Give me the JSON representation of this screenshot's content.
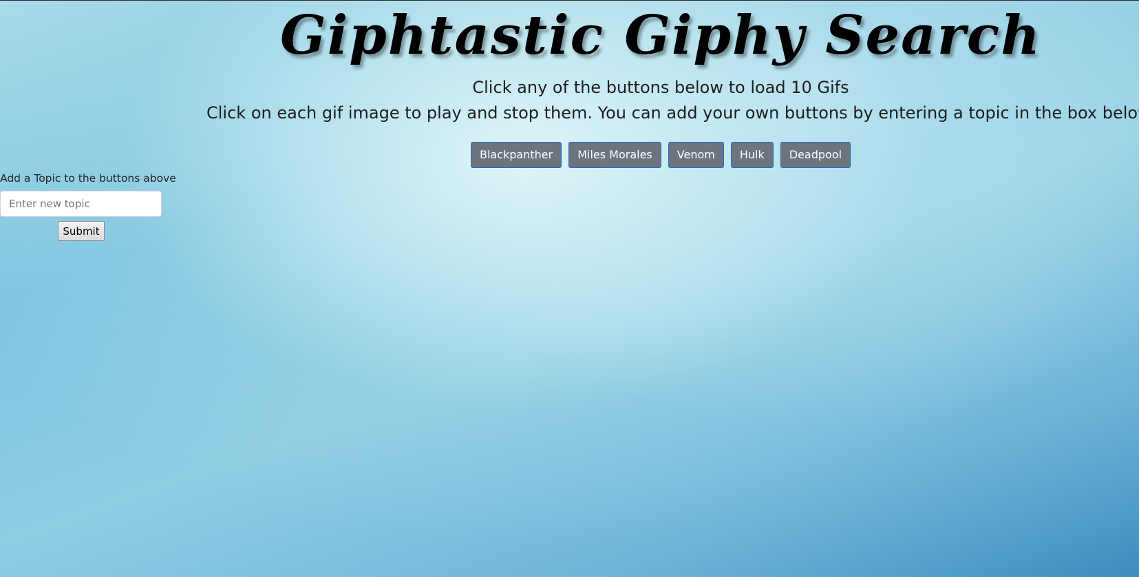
{
  "page": {
    "title": "Giphtastic Giphy Search",
    "instruction_1": "Click any of the buttons below to load 10 Gifs",
    "instruction_2": "Click on each gif image to play and stop them. You can add your own buttons by entering a topic in the box below."
  },
  "topics": {
    "buttons": [
      {
        "label": "Blackpanther"
      },
      {
        "label": "Miles Morales"
      },
      {
        "label": "Venom"
      },
      {
        "label": "Hulk"
      },
      {
        "label": "Deadpool"
      }
    ]
  },
  "add_form": {
    "label": "Add a Topic to the buttons above",
    "input_placeholder": "Enter new topic",
    "input_value": "",
    "submit_label": "Submit"
  },
  "colors": {
    "topic_button_bg": "#6c757d",
    "topic_button_border": "#1a6fd0",
    "title_text": "#000000"
  }
}
